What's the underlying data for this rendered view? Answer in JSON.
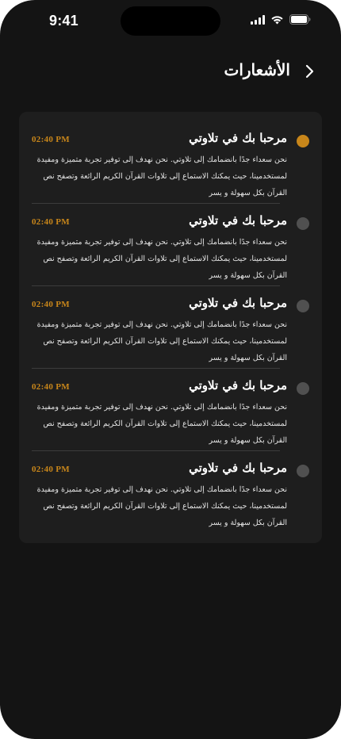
{
  "status_bar": {
    "time": "9:41"
  },
  "header": {
    "title": "الأشعارات"
  },
  "colors": {
    "background": "#141414",
    "card": "#1e1e1e",
    "accent": "#c8861a",
    "read_dot": "#505050"
  },
  "notifications": [
    {
      "title": "مرحبا بك في تلاوتي",
      "time": "02:40 PM",
      "body": "نحن سعداء جدًا بانضمامك إلى تلاوتي. نحن نهدف إلى توفير تجربة متميزة ومفيدة لمستخدمينا، حيث يمكنك الاستماع إلى تلاوات القرآن الكريم الرائعة وتصفح نص القرآن بكل سهولة و يسر",
      "unread": true
    },
    {
      "title": "مرحبا بك في تلاوتي",
      "time": "02:40 PM",
      "body": "نحن سعداء جدًا بانضمامك إلى تلاوتي. نحن نهدف إلى توفير تجربة متميزة ومفيدة لمستخدمينا، حيث يمكنك الاستماع إلى تلاوات القرآن الكريم الرائعة وتصفح نص القرآن بكل سهولة و يسر",
      "unread": false
    },
    {
      "title": "مرحبا بك في تلاوتي",
      "time": "02:40 PM",
      "body": "نحن سعداء جدًا بانضمامك إلى تلاوتي. نحن نهدف إلى توفير تجربة متميزة ومفيدة لمستخدمينا، حيث يمكنك الاستماع إلى تلاوات القرآن الكريم الرائعة وتصفح نص القرآن بكل سهولة و يسر",
      "unread": false
    },
    {
      "title": "مرحبا بك في تلاوتي",
      "time": "02:40 PM",
      "body": "نحن سعداء جدًا بانضمامك إلى تلاوتي. نحن نهدف إلى توفير تجربة متميزة ومفيدة لمستخدمينا، حيث يمكنك الاستماع إلى تلاوات القرآن الكريم الرائعة وتصفح نص القرآن بكل سهولة و يسر",
      "unread": false
    },
    {
      "title": "مرحبا بك في تلاوتي",
      "time": "02:40 PM",
      "body": "نحن سعداء جدًا بانضمامك إلى تلاوتي. نحن نهدف إلى توفير تجربة متميزة ومفيدة لمستخدمينا، حيث يمكنك الاستماع إلى تلاوات القرآن الكريم الرائعة وتصفح نص القرآن بكل سهولة و يسر",
      "unread": false
    }
  ]
}
